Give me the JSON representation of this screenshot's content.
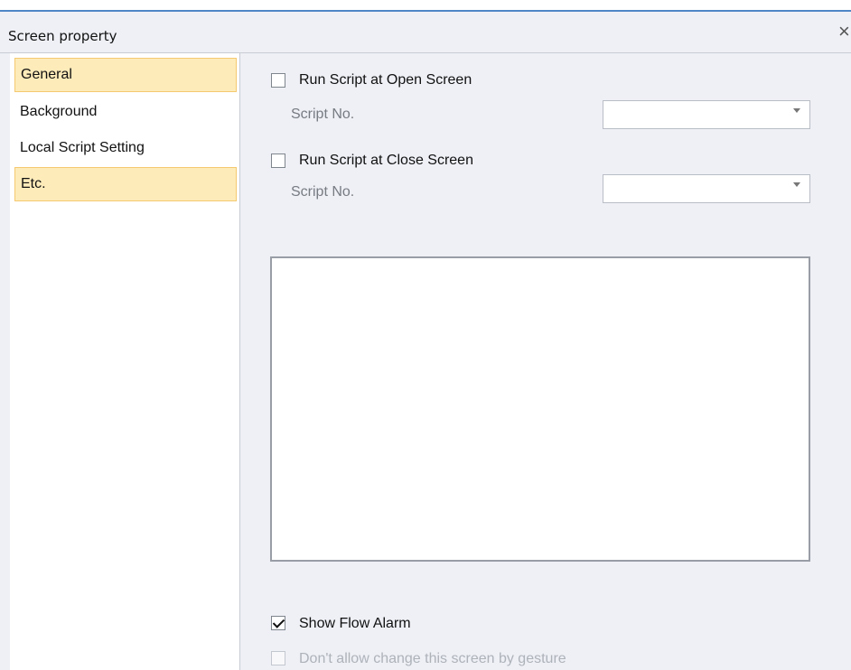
{
  "window": {
    "title": "Screen property",
    "close_glyph": "×"
  },
  "sidebar": {
    "items": [
      {
        "label": "General",
        "state": "selected"
      },
      {
        "label": "Background",
        "state": "normal"
      },
      {
        "label": "Local Script Setting",
        "state": "normal"
      },
      {
        "label": "Etc.",
        "state": "selected"
      }
    ]
  },
  "etc_panel": {
    "open_script": {
      "label": "Run Script at Open Screen",
      "checked": false,
      "script_no_label": "Script No.",
      "selected_value": ""
    },
    "close_script": {
      "label": "Run Script at Close Screen",
      "checked": false,
      "script_no_label": "Script No.",
      "selected_value": ""
    },
    "preview_area_text": "",
    "show_flow_alarm": {
      "label": "Show Flow Alarm",
      "checked": true
    },
    "disallow_gesture_change": {
      "label": "Don't allow change this screen by gesture",
      "checked": false,
      "enabled": false
    }
  },
  "colors": {
    "selected_bg": "#fdebb9",
    "selected_border": "#f4c96f",
    "window_bg": "#eef0f6",
    "panel_bg": "#ffffff",
    "top_accent": "#4f86c6"
  },
  "icons": {
    "close": "close-icon",
    "dropdown": "chevron-down-icon",
    "checkbox": "checkbox-icon"
  }
}
